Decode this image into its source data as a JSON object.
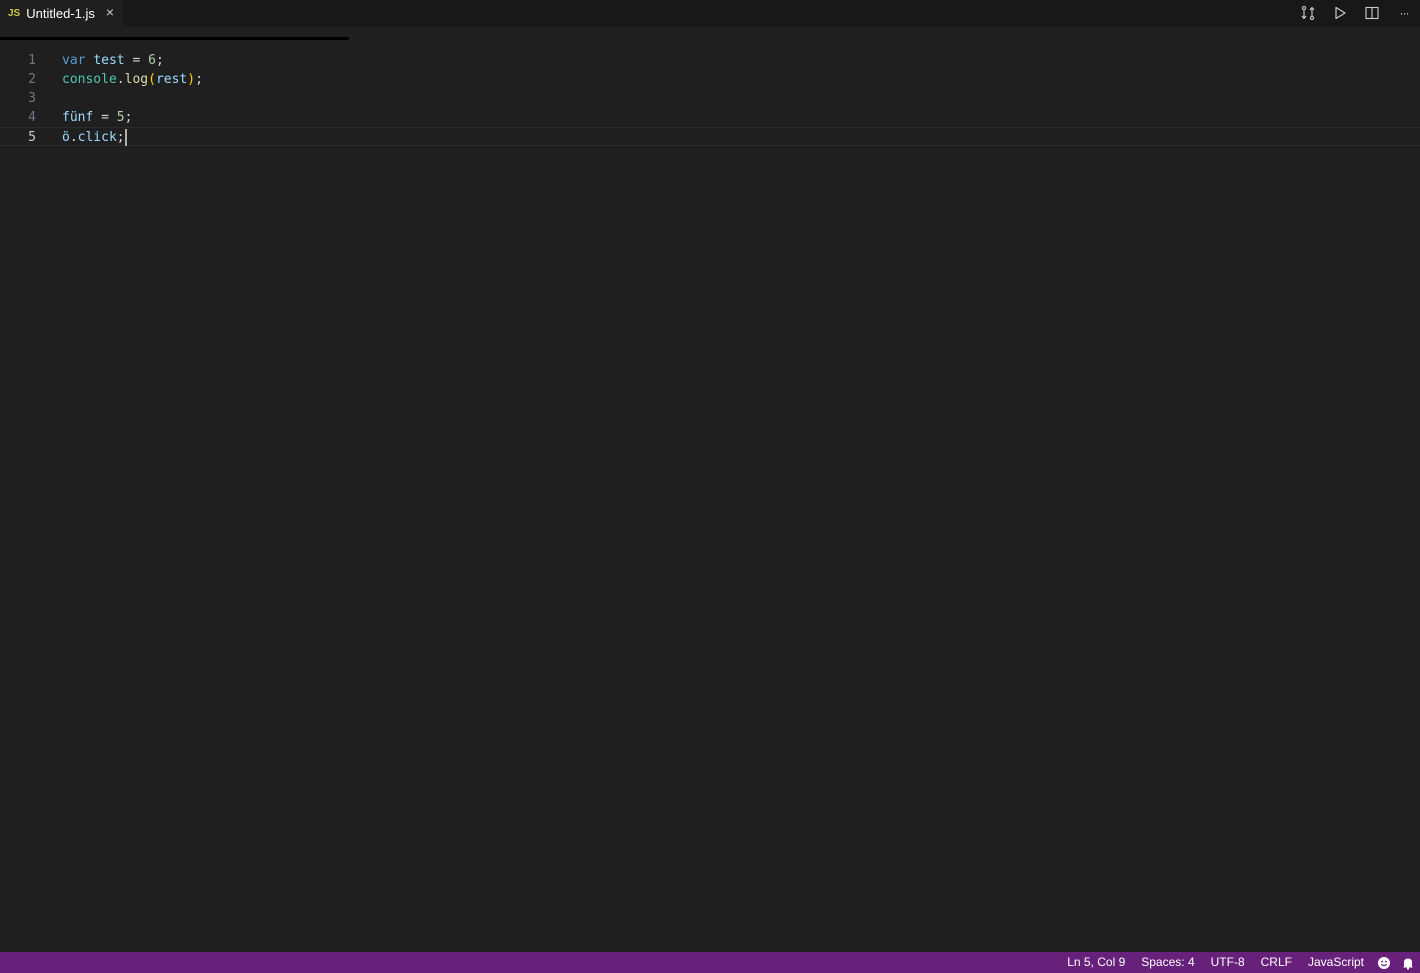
{
  "tab": {
    "lang_badge": "JS",
    "title": "Untitled-1.js",
    "close_glyph": "×"
  },
  "editor_actions": [
    {
      "icon": "compare-changes-icon"
    },
    {
      "icon": "run-icon"
    },
    {
      "icon": "split-editor-icon"
    },
    {
      "icon": "more-actions-icon",
      "glyph": "···"
    }
  ],
  "editor": {
    "lines": [
      {
        "number": "1",
        "tokens": [
          {
            "t": "var",
            "c": "kw"
          },
          {
            "t": " ",
            "c": "op"
          },
          {
            "t": "test",
            "c": "var"
          },
          {
            "t": " = ",
            "c": "op"
          },
          {
            "t": "6",
            "c": "num"
          },
          {
            "t": ";",
            "c": "op"
          }
        ]
      },
      {
        "number": "2",
        "tokens": [
          {
            "t": "console",
            "c": "cls"
          },
          {
            "t": ".",
            "c": "op"
          },
          {
            "t": "log",
            "c": "fn"
          },
          {
            "t": "(",
            "c": "brk"
          },
          {
            "t": "rest",
            "c": "var"
          },
          {
            "t": ")",
            "c": "brk"
          },
          {
            "t": ";",
            "c": "op"
          }
        ]
      },
      {
        "number": "3",
        "tokens": []
      },
      {
        "number": "4",
        "tokens": [
          {
            "t": "fünf",
            "c": "var"
          },
          {
            "t": " = ",
            "c": "op"
          },
          {
            "t": "5",
            "c": "num"
          },
          {
            "t": ";",
            "c": "op"
          }
        ]
      },
      {
        "number": "5",
        "tokens": [
          {
            "t": "ö",
            "c": "var"
          },
          {
            "t": ".",
            "c": "op"
          },
          {
            "t": "click",
            "c": "var"
          },
          {
            "t": ";",
            "c": "op"
          }
        ],
        "current": true
      }
    ]
  },
  "statusbar": {
    "position": "Ln 5, Col 9",
    "indent": "Spaces: 4",
    "encoding": "UTF-8",
    "eol": "CRLF",
    "language": "JavaScript"
  },
  "colors": {
    "accent_statusbar": "#68217a",
    "editor_bg": "#1f1f1f",
    "keyword": "#569cd6",
    "variable": "#9cdcfe",
    "number": "#b5cea8",
    "function": "#dcdcaa",
    "class": "#4ec9b0",
    "bracket": "#ffd700"
  }
}
